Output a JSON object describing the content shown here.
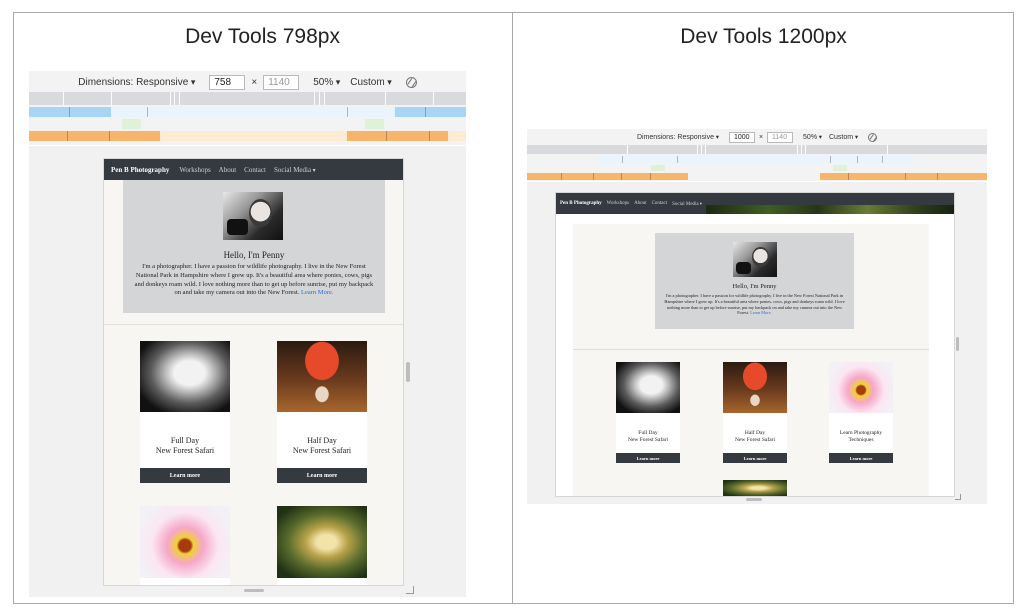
{
  "panels": {
    "left": {
      "title": "Dev Tools 798px"
    },
    "right": {
      "title": "Dev Tools 1200px"
    }
  },
  "devtools_left": {
    "dimensions_label": "Dimensions: Responsive",
    "width_value": "758",
    "height_placeholder": "1140",
    "times": "×",
    "zoom": "50%",
    "throttle": "Custom"
  },
  "devtools_right": {
    "dimensions_label": "Dimensions: Responsive",
    "width_value": "1000",
    "height_placeholder": "1140",
    "times": "×",
    "zoom": "50%",
    "throttle": "Custom"
  },
  "site": {
    "brand": "Pen B Photography",
    "nav": [
      "Workshops",
      "About",
      "Contact",
      "Social Media"
    ],
    "hero_title": "Hello, I'm Penny",
    "hero_text": "I'm a photographer. I have a passion for wildlife photography. I live in the New Forest National Park in Hampshire where I grew up. It's a beautiful area where ponies, cows, pigs and donkeys roam wild. I love nothing more than to get up before sunrise, put my backpack on and take my camera out into the New Forest.",
    "hero_more": "Learn More.",
    "cards": [
      {
        "line1": "Full Day",
        "line2": "New Forest Safari",
        "button": "Learn more"
      },
      {
        "line1": "Half Day",
        "line2": "New Forest Safari",
        "button": "Learn more"
      },
      {
        "line1": "Learn Photography",
        "line2": "Techniques",
        "button": "Learn more"
      }
    ]
  },
  "colors": {
    "nav_bg": "#343a40",
    "mq_blue": "#a8d4f5",
    "mq_green": "#dff1d9",
    "mq_orange": "#f6b56b",
    "hero_bg": "#d4d5d7"
  },
  "icons": [
    "rotate-icon",
    "chevron-down-icon"
  ]
}
